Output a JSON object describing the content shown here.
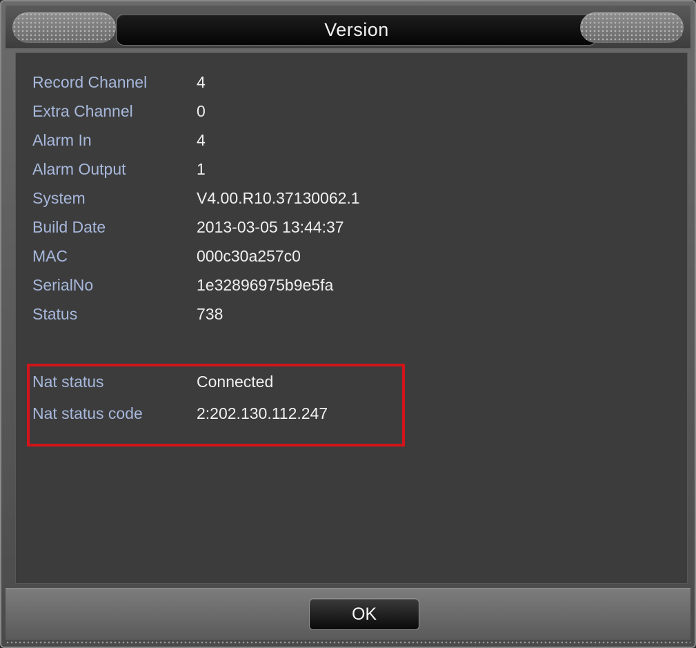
{
  "window": {
    "title": "Version"
  },
  "info_rows": [
    {
      "label": "Record Channel",
      "value": "4"
    },
    {
      "label": "Extra Channel",
      "value": "0"
    },
    {
      "label": "Alarm In",
      "value": "4"
    },
    {
      "label": "Alarm Output",
      "value": "1"
    },
    {
      "label": "System",
      "value": "V4.00.R10.37130062.1"
    },
    {
      "label": "Build Date",
      "value": "2013-03-05 13:44:37"
    },
    {
      "label": "MAC",
      "value": "000c30a257c0"
    },
    {
      "label": "SerialNo",
      "value": "1e32896975b9e5fa"
    },
    {
      "label": "Status",
      "value": "738"
    }
  ],
  "nat_rows": [
    {
      "label": "Nat status",
      "value": "Connected"
    },
    {
      "label": "Nat status code",
      "value": "2:202.130.112.247"
    }
  ],
  "footer": {
    "ok_label": "OK"
  },
  "colors": {
    "label_text": "#a7b8dc",
    "value_text": "#f0f0f0",
    "highlight_border": "#d2141a",
    "panel_bg": "#3c3c3c"
  }
}
